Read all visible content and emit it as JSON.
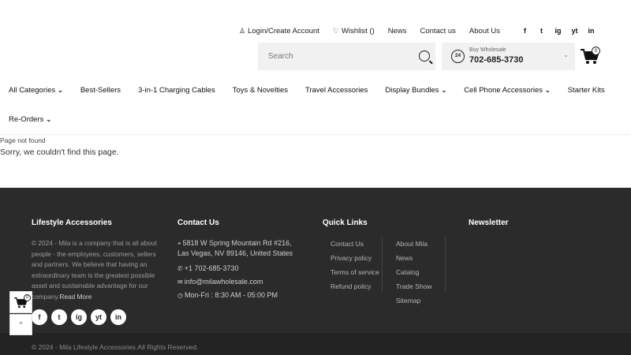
{
  "header": {
    "top_links": [
      {
        "icon": "user-icon",
        "glyph": "♙",
        "label": "Login/Create Account"
      },
      {
        "icon": "heart-icon",
        "glyph": "♡",
        "label": "Wishlist ()"
      },
      {
        "icon": "",
        "glyph": "",
        "label": "News"
      },
      {
        "icon": "",
        "glyph": "",
        "label": "Contact us"
      },
      {
        "icon": "",
        "glyph": "",
        "label": "About Us"
      }
    ],
    "social": [
      "f",
      "t",
      "ig",
      "yt",
      "in"
    ],
    "search_placeholder": "Search",
    "phone_label": "Buy Wholesale",
    "phone_number": "702-685-3730",
    "phone_badge": "24",
    "cart_count": "0"
  },
  "nav": {
    "row1": [
      {
        "label": "All Categories",
        "dropdown": true
      },
      {
        "label": "Best-Sellers",
        "dropdown": false
      },
      {
        "label": "3-in-1 Charging Cables",
        "dropdown": false
      },
      {
        "label": "Toys & Novelties",
        "dropdown": false
      },
      {
        "label": "Travel Accessories",
        "dropdown": false
      },
      {
        "label": "Display Bundles",
        "dropdown": true
      },
      {
        "label": "Cell Phone Accessories",
        "dropdown": true
      },
      {
        "label": "Starter Kits",
        "dropdown": false
      }
    ],
    "row2": [
      {
        "label": "Re-Orders",
        "dropdown": true
      }
    ]
  },
  "main": {
    "breadcrumb": "Page not found",
    "message": "Sorry, we couldn't find this page."
  },
  "footer": {
    "about_title": "Lifestyle Accessories",
    "about_text": "© 2024 - Mila is a company that is all about people - the employees, customers, sellers and partners. We believe that having an extraordinary team is the greatest possible asset and sustainable advantage for our company.",
    "read_more": "Read More",
    "contact_title": "Contact Us",
    "address": "5818 W Spring Mountain Rd #216, Las Vegas, NV 89146, United States",
    "phone": "+1 702-685-3730",
    "email": "info@milawholesale.com",
    "hours": "Mon-Fri : 8:30 AM - 05:00 PM",
    "quick_links_title": "Quick Links",
    "quick_links_col1": [
      "Contact Us",
      "Privacy policy",
      "Terms of service",
      "Refund policy"
    ],
    "quick_links_col2": [
      "About Mila",
      "News",
      "Catalog",
      "Trade Show",
      "Sitemap"
    ],
    "newsletter_title": "Newsletter",
    "social": [
      "f",
      "t",
      "ig",
      "yt",
      "in"
    ],
    "copyright": "© 2024 - Mila Lifestyle Accessories.All Rights Reserved."
  },
  "floating": {
    "cart_count": "0",
    "back_to_top": "^"
  }
}
